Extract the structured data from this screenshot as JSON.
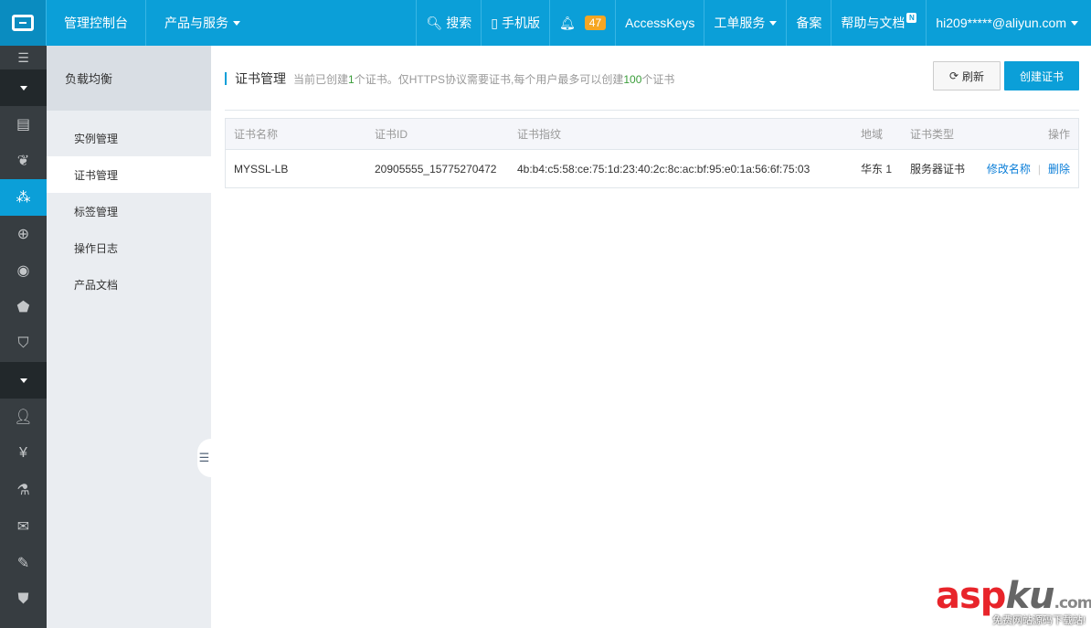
{
  "topbar": {
    "console": "管理控制台",
    "products": "产品与服务",
    "search": "搜索",
    "mobile": "手机版",
    "notifications_count": "47",
    "accesskeys": "AccessKeys",
    "tickets": "工单服务",
    "beian": "备案",
    "help": "帮助与文档",
    "help_badge": "N",
    "user": "hi209*****@aliyun.com"
  },
  "iconbar": {
    "items": [
      "menu-icon",
      "expand-icon",
      "server-icon",
      "dog-icon",
      "slb-icon",
      "globe-icon",
      "dns-icon",
      "shield-icon",
      "monitor-icon",
      "expand-icon",
      "user-icon",
      "yen-icon",
      "flask-icon",
      "mail-icon",
      "pen-icon",
      "badge-icon"
    ]
  },
  "subnav": {
    "title": "负载均衡",
    "items": [
      "实例管理",
      "证书管理",
      "标签管理",
      "操作日志",
      "产品文档"
    ]
  },
  "page": {
    "title": "证书管理",
    "desc_prefix": "当前已创建",
    "desc_count": "1",
    "desc_middle": "个证书。仅HTTPS协议需要证书,每个用户最多可以创建",
    "desc_max": "100",
    "desc_suffix": "个证书",
    "refresh_label": "刷新",
    "create_label": "创建证书"
  },
  "table": {
    "headers": [
      "证书名称",
      "证书ID",
      "证书指纹",
      "地域",
      "证书类型",
      "操作"
    ],
    "rows": [
      {
        "name": "MYSSL-LB",
        "id": "20905555_15775270472",
        "fingerprint": "4b:b4:c5:58:ce:75:1d:23:40:2c:8c:ac:bf:95:e0:1a:56:6f:75:03",
        "region": "华东 1",
        "type": "服务器证书",
        "action_rename": "修改名称",
        "action_sep": "|",
        "action_delete": "删除"
      }
    ]
  },
  "watermark": {
    "brand_asp": "asp",
    "brand_ku": "ku",
    "brand_com": ".com",
    "tagline": "免费网站源码下载站!"
  },
  "colors": {
    "topbar": "#0b9fd8",
    "iconbar": "#373d41",
    "subnav": "#eaedf1",
    "accent": "#0b9fd8",
    "badge": "#f5a623"
  }
}
